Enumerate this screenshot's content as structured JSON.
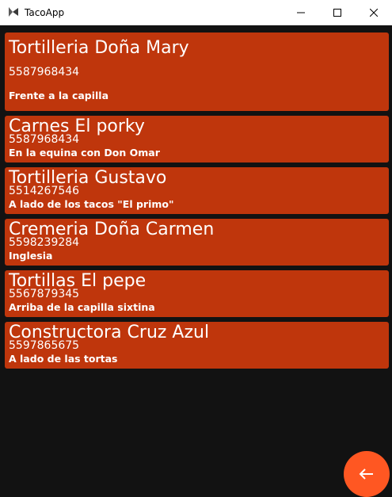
{
  "window": {
    "title": "TacoApp"
  },
  "contacts": [
    {
      "name": "Tortilleria Doña Mary",
      "phone": "5587968434",
      "address": "Frente a la capilla"
    },
    {
      "name": "Carnes El porky",
      "phone": "5587968434",
      "address": "En la equina con Don Omar"
    },
    {
      "name": "Tortilleria Gustavo",
      "phone": "5514267546",
      "address": "A lado de los tacos \"El primo\""
    },
    {
      "name": "Cremeria Doña Carmen",
      "phone": "5598239284",
      "address": "Inglesia"
    },
    {
      "name": "Tortillas El pepe",
      "phone": "5567879345",
      "address": "Arriba de la capilla sixtina"
    },
    {
      "name": "Constructora Cruz Azul",
      "phone": "5597865675",
      "address": "A lado de las tortas"
    }
  ],
  "colors": {
    "card": "#bf360c",
    "background": "#121212",
    "fab": "#ff5722"
  },
  "icons": {
    "fab": "arrow-left-icon",
    "app": "kivy-logo-icon"
  }
}
